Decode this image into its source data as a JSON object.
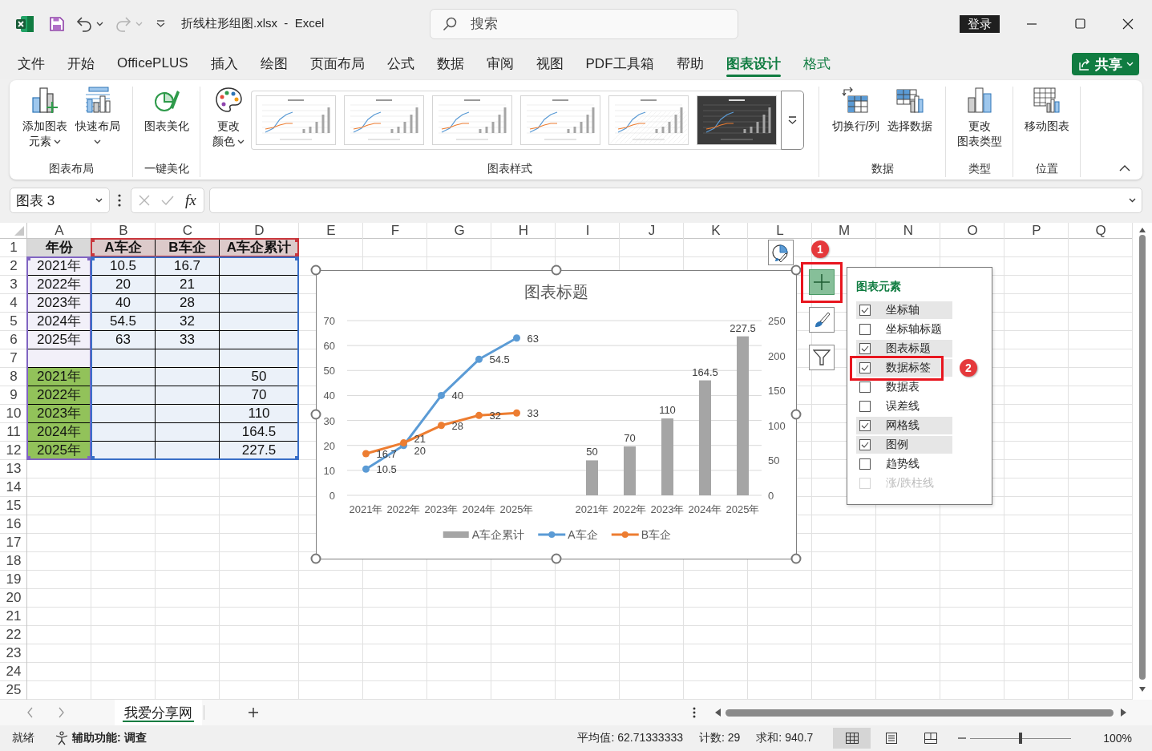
{
  "title_bar": {
    "quick_access": [
      {
        "disabled": false
      },
      {
        "disabled": false
      },
      {
        "disabled": true
      }
    ],
    "title": "折线柱形组图.xlsx  -  Excel",
    "search": {
      "placeholder": "搜索"
    },
    "sign_in": "登录"
  },
  "menu_tabs": [
    {
      "label": "文件",
      "kind": "standard",
      "selected": false
    },
    {
      "label": "开始",
      "kind": "standard",
      "selected": false
    },
    {
      "label": "OfficePLUS",
      "kind": "standard",
      "selected": false
    },
    {
      "label": "插入",
      "kind": "standard",
      "selected": false
    },
    {
      "label": "绘图",
      "kind": "standard",
      "selected": false
    },
    {
      "label": "页面布局",
      "kind": "standard",
      "selected": false
    },
    {
      "label": "公式",
      "kind": "standard",
      "selected": false
    },
    {
      "label": "数据",
      "kind": "standard",
      "selected": false
    },
    {
      "label": "审阅",
      "kind": "standard",
      "selected": false
    },
    {
      "label": "视图",
      "kind": "standard",
      "selected": false
    },
    {
      "label": "PDF工具箱",
      "kind": "standard",
      "selected": false
    },
    {
      "label": "帮助",
      "kind": "standard",
      "selected": false
    },
    {
      "label": "图表设计",
      "kind": "contextual",
      "selected": true
    },
    {
      "label": "格式",
      "kind": "contextual",
      "selected": false
    }
  ],
  "share_button": "共享",
  "ribbon": {
    "groups": [
      {
        "label": "图表布局",
        "buttons": [
          {
            "lines": [
              "添加图表",
              "元素"
            ],
            "dropdown": true
          },
          {
            "lines": [
              "快速布局"
            ],
            "dropdown": true
          }
        ]
      },
      {
        "label": "一键美化",
        "buttons": [
          {
            "lines": [
              "图表美化"
            ],
            "dropdown": false
          }
        ]
      },
      {
        "label": "图表样式",
        "buttons": [
          {
            "lines": [
              "更改",
              "颜色"
            ],
            "dropdown": true
          }
        ],
        "gallery": [
          {
            "kind": "light",
            "selected": false
          },
          {
            "kind": "light",
            "selected": false
          },
          {
            "kind": "light",
            "selected": false
          },
          {
            "kind": "light",
            "selected": false
          },
          {
            "kind": "pattern",
            "selected": false
          },
          {
            "kind": "dark",
            "selected": false
          }
        ]
      },
      {
        "label": "数据",
        "buttons": [
          {
            "lines": [
              "切换行/列"
            ],
            "dropdown": false
          },
          {
            "lines": [
              "选择数据"
            ],
            "dropdown": false
          }
        ]
      },
      {
        "label": "类型",
        "buttons": [
          {
            "lines": [
              "更改",
              "图表类型"
            ],
            "dropdown": false
          }
        ]
      },
      {
        "label": "位置",
        "buttons": [
          {
            "lines": [
              "移动图表"
            ],
            "dropdown": false
          }
        ]
      }
    ]
  },
  "formula_bar": {
    "name_box": "图表 3",
    "function_button": "fx"
  },
  "sheet": {
    "columns": [
      "A",
      "B",
      "C",
      "D",
      "E",
      "F",
      "G",
      "H",
      "I",
      "J",
      "K",
      "L",
      "M",
      "N",
      "O",
      "P",
      "Q"
    ],
    "rows": [
      {
        "number": "1",
        "kind": "header",
        "cells": [
          {
            "text": "年份",
            "color": "#d9d9d9"
          },
          {
            "text": "A车企",
            "color": "#dccaca"
          },
          {
            "text": "B车企",
            "color": "#dccaca"
          },
          {
            "text": "A车企累计",
            "color": "#dccaca"
          }
        ]
      },
      {
        "number": "2",
        "kind": "data",
        "cells": [
          {
            "text": "2021年"
          },
          {
            "text": "10.5"
          },
          {
            "text": "16.7"
          },
          null
        ]
      },
      {
        "number": "3",
        "kind": "data",
        "cells": [
          {
            "text": "2022年"
          },
          {
            "text": "20"
          },
          {
            "text": "21"
          },
          null
        ]
      },
      {
        "number": "4",
        "kind": "data",
        "cells": [
          {
            "text": "2023年"
          },
          {
            "text": "40"
          },
          {
            "text": "28"
          },
          null
        ]
      },
      {
        "number": "5",
        "kind": "data",
        "cells": [
          {
            "text": "2024年"
          },
          {
            "text": "54.5"
          },
          {
            "text": "32"
          },
          null
        ]
      },
      {
        "number": "6",
        "kind": "data",
        "cells": [
          {
            "text": "2025年"
          },
          {
            "text": "63"
          },
          {
            "text": "33"
          },
          null
        ]
      },
      {
        "number": "7",
        "kind": "data",
        "cells": [
          null,
          null,
          null,
          null
        ]
      },
      {
        "number": "8",
        "kind": "data",
        "cells": [
          {
            "text": "2021年",
            "color": "#92c25a"
          },
          null,
          null,
          {
            "text": "50"
          }
        ]
      },
      {
        "number": "9",
        "kind": "data",
        "cells": [
          {
            "text": "2022年",
            "color": "#92c25a"
          },
          null,
          null,
          {
            "text": "70"
          }
        ]
      },
      {
        "number": "10",
        "kind": "data",
        "cells": [
          {
            "text": "2023年",
            "color": "#92c25a"
          },
          null,
          null,
          {
            "text": "110"
          }
        ]
      },
      {
        "number": "11",
        "kind": "data",
        "cells": [
          {
            "text": "2024年",
            "color": "#92c25a"
          },
          null,
          null,
          {
            "text": "164.5"
          }
        ]
      },
      {
        "number": "12",
        "kind": "data",
        "cells": [
          {
            "text": "2025年",
            "color": "#92c25a"
          },
          null,
          null,
          {
            "text": "227.5"
          }
        ]
      },
      {
        "number": "13"
      },
      {
        "number": "14"
      },
      {
        "number": "15"
      },
      {
        "number": "16"
      },
      {
        "number": "17"
      },
      {
        "number": "18"
      },
      {
        "number": "19"
      },
      {
        "number": "20"
      },
      {
        "number": "21"
      },
      {
        "number": "22"
      },
      {
        "number": "23"
      },
      {
        "number": "24"
      },
      {
        "number": "25"
      }
    ],
    "chart": {
      "chart_data": {
        "type": "line",
        "title": "图表标题",
        "categories": [
          "2021年",
          "2022年",
          "2023年",
          "2024年",
          "2025年",
          null,
          "2021年",
          "2022年",
          "2023年",
          "2024年",
          "2025年"
        ],
        "ylim": [
          0,
          70
        ],
        "yticks": [
          {
            "value": 0,
            "label": "0"
          },
          {
            "value": 10,
            "label": "10"
          },
          {
            "value": 20,
            "label": "20"
          },
          {
            "value": 30,
            "label": "30"
          },
          {
            "value": 40,
            "label": "40"
          },
          {
            "value": 50,
            "label": "50"
          },
          {
            "value": 60,
            "label": "60"
          },
          {
            "value": 70,
            "label": "70"
          }
        ],
        "y2lim": [
          0,
          250
        ],
        "y2ticks": [
          {
            "value": 0,
            "label": "0"
          },
          {
            "value": 50,
            "label": "50"
          },
          {
            "value": 100,
            "label": "100"
          },
          {
            "value": 150,
            "label": "150"
          },
          {
            "value": 200,
            "label": "200"
          },
          {
            "value": 250,
            "label": "250"
          }
        ],
        "grid": true,
        "legend": "bottom",
        "data_labels": true,
        "series": [
          {
            "name": "A车企累计",
            "type": "bar",
            "axis": "y2",
            "color": "#a5a5a5",
            "values": [
              null,
              null,
              null,
              null,
              null,
              null,
              50,
              70,
              110,
              164.5,
              227.5
            ],
            "value_labels": [
              null,
              null,
              null,
              null,
              null,
              null,
              "50",
              "70",
              "110",
              "164.5",
              "227.5"
            ]
          },
          {
            "name": "A车企",
            "color": "#5b9bd5",
            "marker": true,
            "values": [
              10.5,
              20,
              40,
              54.5,
              63,
              null,
              null,
              null,
              null,
              null,
              null
            ],
            "value_labels": [
              "10.5",
              "20",
              "40",
              "54.5",
              "63",
              null,
              null,
              null,
              null,
              null,
              null
            ]
          },
          {
            "name": "B车企",
            "color": "#ed7d31",
            "marker": true,
            "values": [
              16.7,
              21,
              28,
              32,
              33,
              null,
              null,
              null,
              null,
              null,
              null
            ],
            "value_labels": [
              "16.7",
              "21",
              "28",
              "32",
              "33",
              null,
              null,
              null,
              null,
              null,
              null
            ]
          }
        ]
      }
    },
    "chart_buttons": [
      {
        "kind": "elements",
        "selected": true,
        "annotation": "1"
      },
      {
        "kind": "styles",
        "selected": false
      },
      {
        "kind": "filters",
        "selected": false
      }
    ],
    "chart_elements": {
      "title": "图表元素",
      "items": [
        {
          "label": "坐标轴",
          "checked": true,
          "disabled": false
        },
        {
          "label": "坐标轴标题",
          "checked": false,
          "disabled": false
        },
        {
          "label": "图表标题",
          "checked": true,
          "disabled": false
        },
        {
          "label": "数据标签",
          "checked": true,
          "disabled": false,
          "annotation": "2"
        },
        {
          "label": "数据表",
          "checked": false,
          "disabled": false
        },
        {
          "label": "误差线",
          "checked": false,
          "disabled": false
        },
        {
          "label": "网格线",
          "checked": true,
          "disabled": false
        },
        {
          "label": "图例",
          "checked": true,
          "disabled": false
        },
        {
          "label": "趋势线",
          "checked": false,
          "disabled": false
        },
        {
          "label": "涨/跌柱线",
          "checked": false,
          "disabled": true
        }
      ]
    }
  },
  "sheet_tabs": [
    {
      "label": "我爱分享网",
      "selected": true
    }
  ],
  "status_bar": {
    "status": "就绪",
    "accessibility": "辅助功能: 调查",
    "statistics": [
      "平均值: 62.71333333",
      "计数: 29",
      "求和: 940.7"
    ],
    "views": [
      {
        "selected": true
      },
      {
        "selected": false
      },
      {
        "selected": false
      }
    ],
    "zoom": {
      "level": 0.5,
      "reading": "100%"
    }
  }
}
